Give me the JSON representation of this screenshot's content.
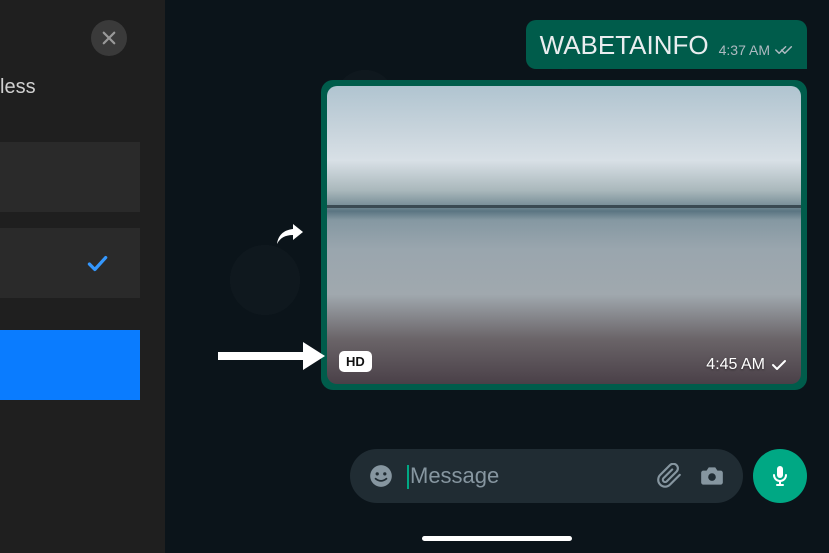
{
  "leftPanel": {
    "partialText": "less"
  },
  "messages": {
    "text": {
      "content": "WABETAINFO",
      "time": "4:37 AM"
    },
    "image": {
      "hdLabel": "HD",
      "time": "4:45 AM"
    }
  },
  "inputBar": {
    "placeholder": "Message"
  }
}
